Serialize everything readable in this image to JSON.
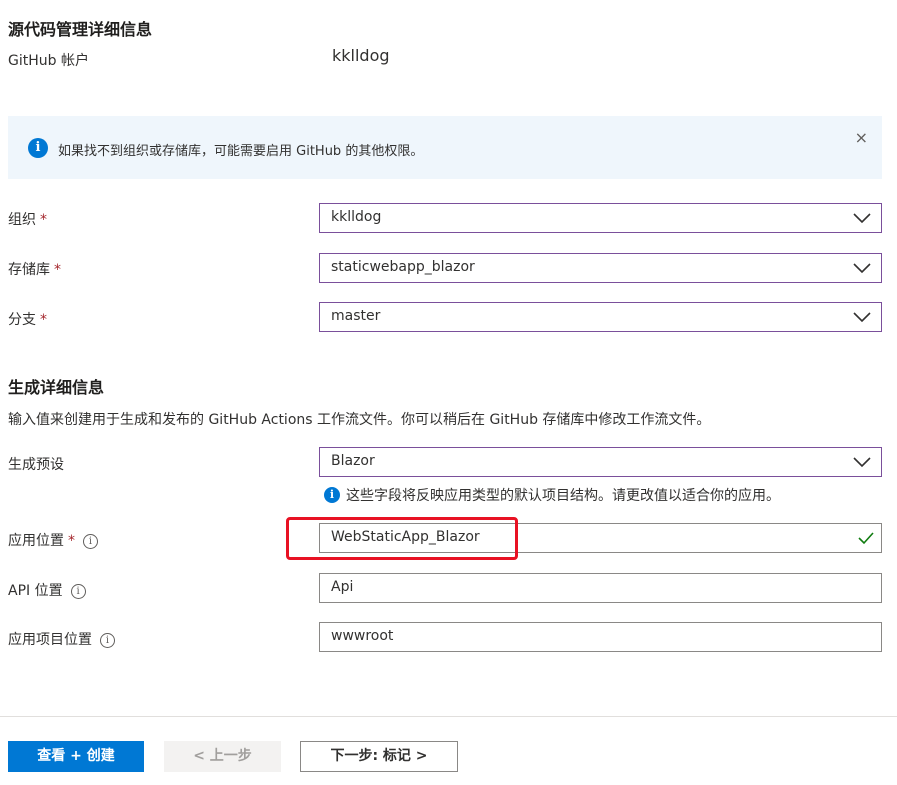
{
  "source_section": {
    "title": "源代码管理详细信息",
    "github_account_label": "GitHub 帐户",
    "github_account_value": "kklldog"
  },
  "infobar": {
    "text": "如果找不到组织或存储库，可能需要启用 GitHub 的其他权限。",
    "close": "×"
  },
  "fields": {
    "org_label": "组织",
    "org_value": "kklldog",
    "repo_label": "存储库",
    "repo_value": "staticwebapp_blazor",
    "branch_label": "分支",
    "branch_value": "master",
    "required_mark": "*"
  },
  "build_section": {
    "title": "生成详细信息",
    "desc": "输入值来创建用于生成和发布的 GitHub Actions 工作流文件。你可以稍后在 GitHub 存储库中修改工作流文件。",
    "preset_label": "生成预设",
    "preset_value": "Blazor",
    "preset_hint": "这些字段将反映应用类型的默认项目结构。请更改值以适合你的应用。",
    "app_location_label": "应用位置",
    "app_location_value": "WebStaticApp_Blazor",
    "api_location_label": "API 位置",
    "api_location_value": "Api",
    "output_location_label": "应用项目位置",
    "output_location_value": "wwwroot"
  },
  "footer": {
    "review_create": "查看 + 创建",
    "prev": "< 上一步",
    "next": "下一步: 标记 >"
  },
  "colors": {
    "primary": "#0078d4",
    "required": "#a4262c",
    "highlight": "#e81123",
    "valid": "#107c10",
    "dropdown_border": "#7a4f9b"
  }
}
